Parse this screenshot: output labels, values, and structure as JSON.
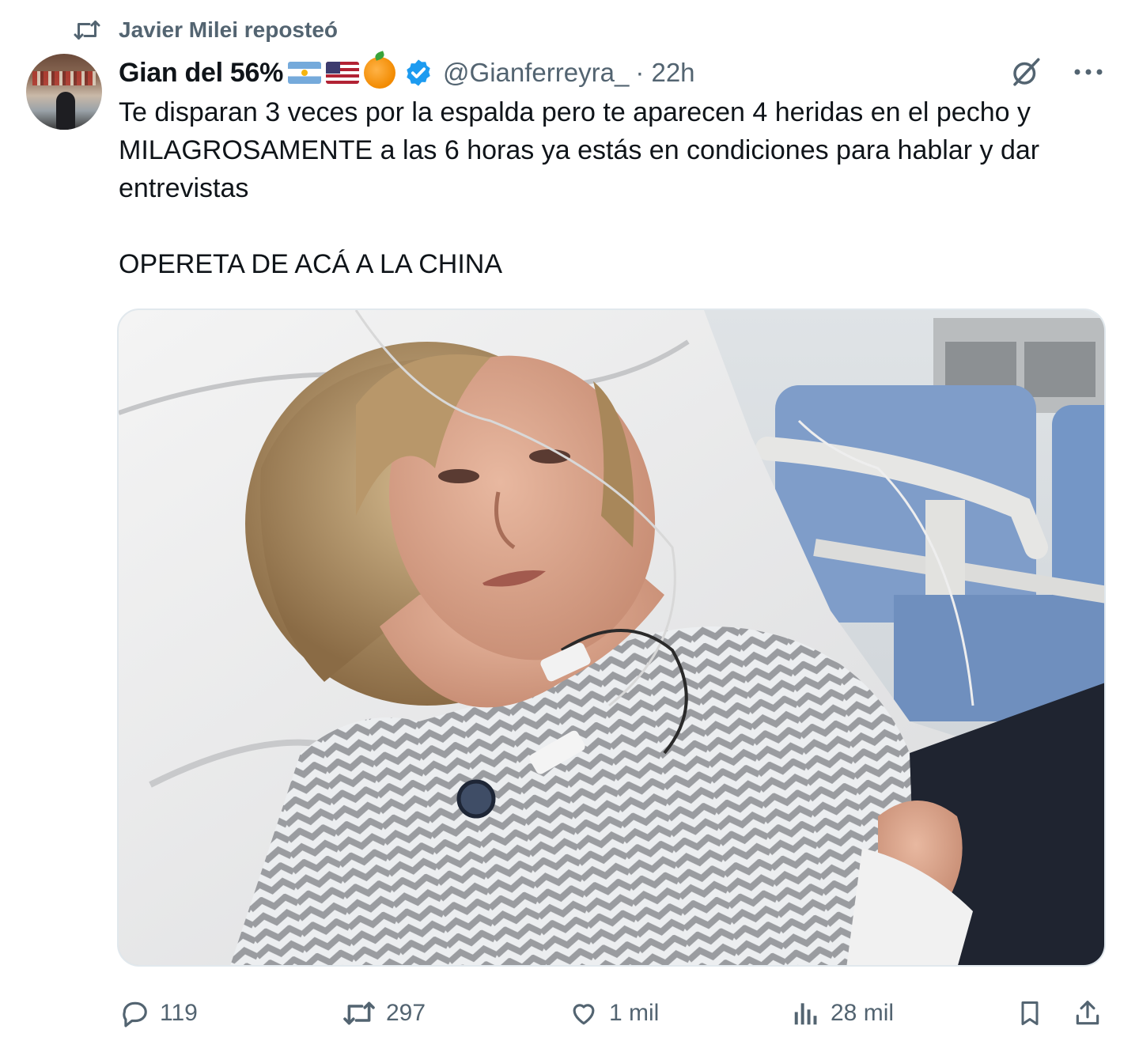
{
  "repost": {
    "label": "Javier Milei reposteó",
    "icon": "retweet-icon"
  },
  "author": {
    "display_name": "Gian del 56%",
    "badges": [
      "flag-argentina",
      "flag-usa",
      "orange-emoji",
      "verified-badge"
    ],
    "handle": "@Gianferreyra_",
    "time": "· 22h"
  },
  "tweet": {
    "paragraph_1": "Te disparan 3 veces por la espalda pero te aparecen 4 heridas en el pecho y\nMILAGROSAMENTE a las 6 horas ya estás en condiciones para hablar y dar\nentrevistas",
    "paragraph_2": "OPERETA DE ACÁ A LA CHINA"
  },
  "media": {
    "kind": "photo"
  },
  "stats": {
    "replies": "119",
    "reposts": "297",
    "likes": "1 mil",
    "views": "28 mil"
  },
  "colors": {
    "text": "#0f1419",
    "secondary": "#536471",
    "verified": "#1d9bf0",
    "border": "#e1e8ed"
  }
}
